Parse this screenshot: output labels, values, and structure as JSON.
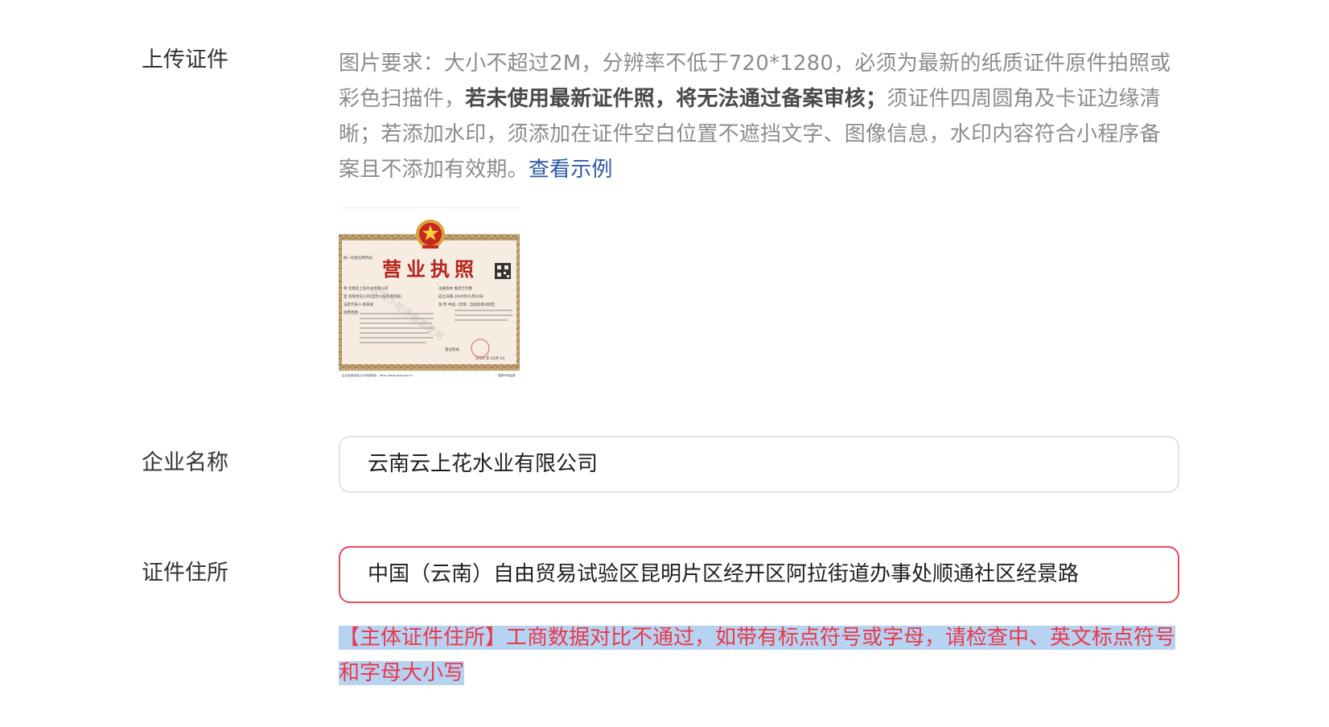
{
  "upload": {
    "label": "上传证件",
    "req_text_1": "图片要求：大小不超过2M，分辨率不低于720*1280，必须为最新的纸质证件原件拍照或彩色扫描件，",
    "req_bold": "若未使用最新证件照，将无法通过备案审核；",
    "req_text_2": "须证件四周圆角及卡证边缘清晰；若添加水印，须添加在证件空白位置不遮挡文字、图像信息，水印内容符合小程序备案且不添加有效期。",
    "view_example_link": "查看示例"
  },
  "license_image": {
    "title": "营业执照",
    "left_text": "统一社会信用代码",
    "name_row": "称 云南云上花水业有限公司",
    "type_row": "型 有限责任公司(自然人投资或控股)",
    "rep_row": "法定代表人 杨某某",
    "scope_row": "经营范围",
    "capital_row": "注册资本 壹佰万元整",
    "date_row": "成立日期 2024年01月24日",
    "addr_row": "住 所 中国（云南）自由贸易试验区",
    "authority": "登记机关",
    "footer_left": "企业信用信息公示系统网址：http://www.gsxt.gov.cn",
    "footer_right": "国家市场监督",
    "date_bottom": "2024 年 01月 24",
    "watermark": "仅限小程序备案使用"
  },
  "company": {
    "label": "企业名称",
    "value": "云南云上花水业有限公司"
  },
  "address": {
    "label": "证件住所",
    "value": "中国（云南）自由贸易试验区昆明片区经开区阿拉街道办事处顺通社区经景路"
  },
  "error": {
    "message": "【主体证件住所】工商数据对比不通过，如带有标点符号或字母，请检查中、英文标点符号和字母大小写"
  },
  "colors": {
    "label": "#333333",
    "hint": "#8c8c8c",
    "link": "#2e5aa8",
    "error": "#e8394c",
    "error_border": "#e84a57",
    "highlight": "#b7d3f2"
  }
}
